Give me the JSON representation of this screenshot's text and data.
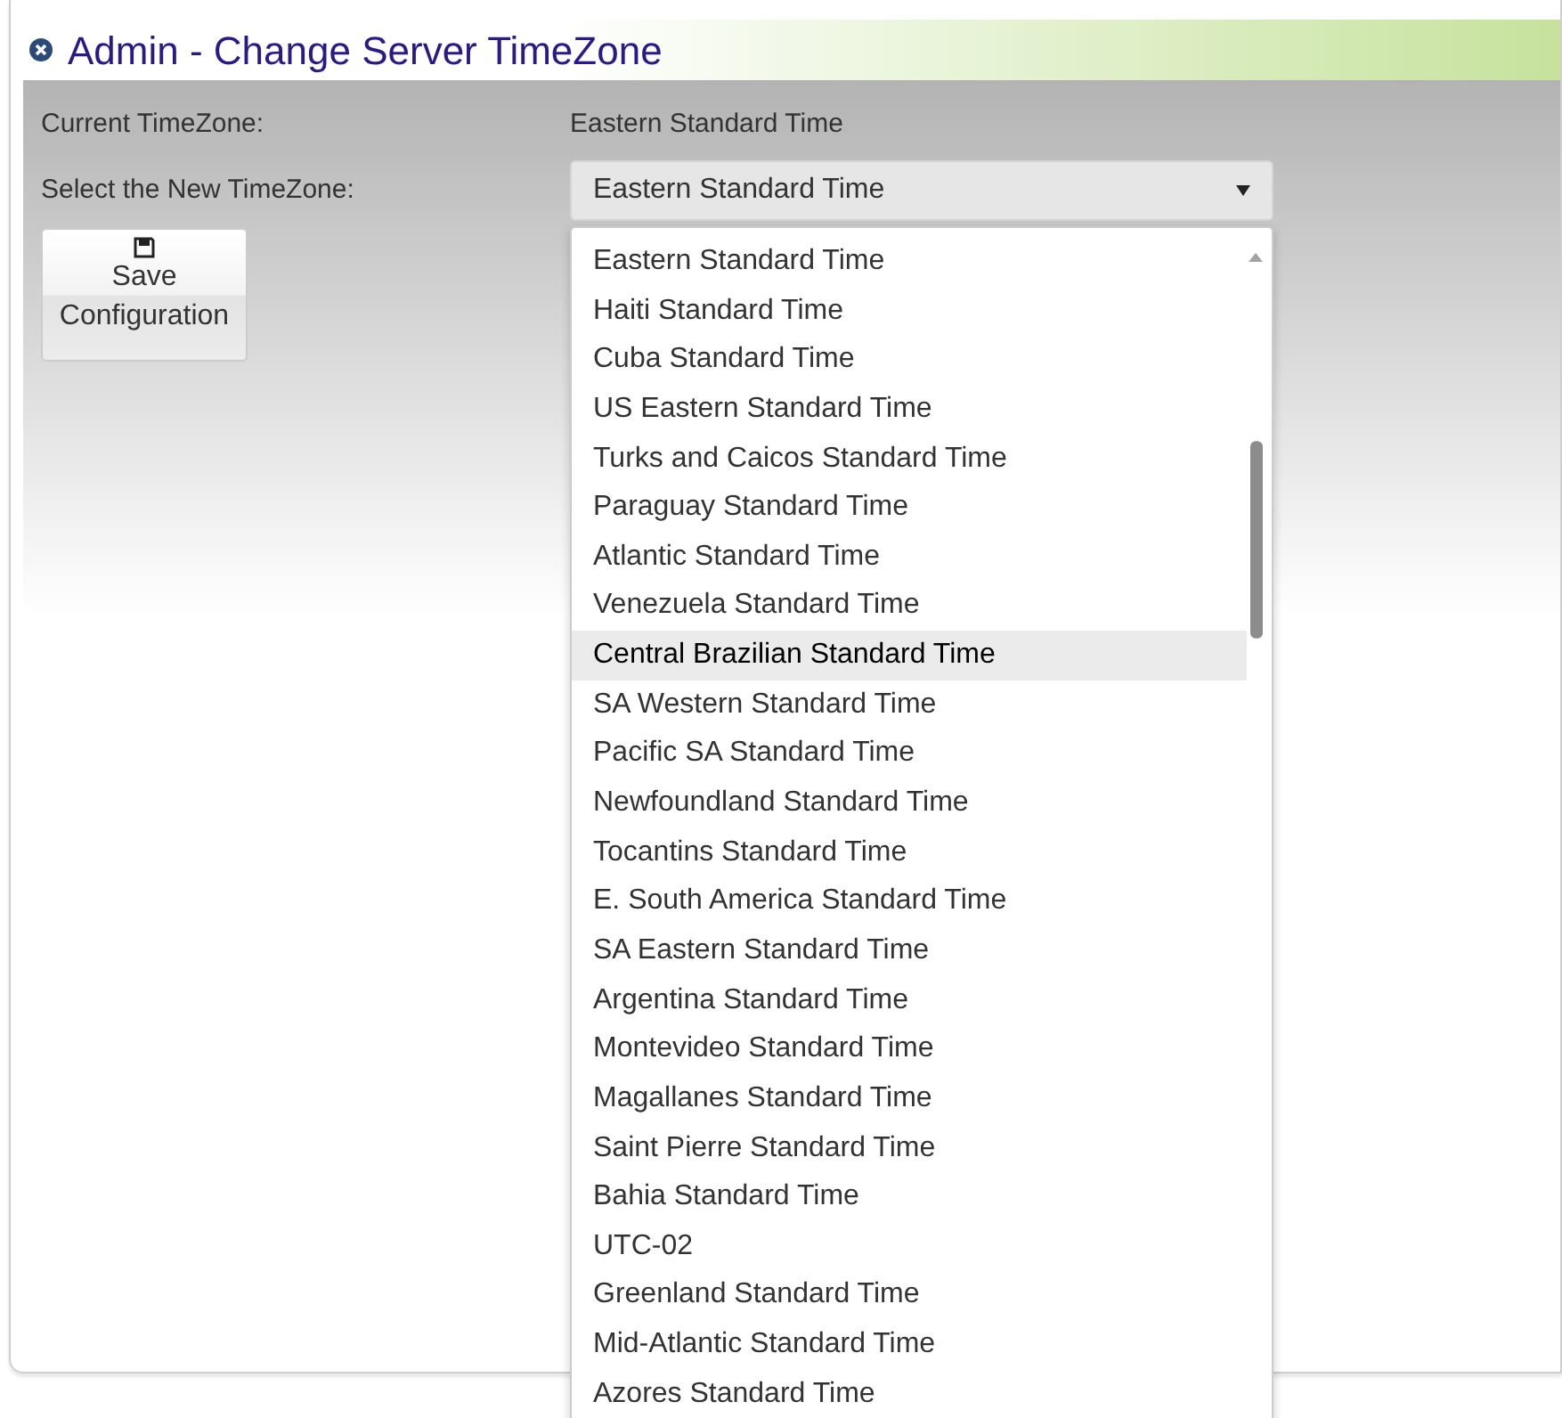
{
  "window": {
    "title": "Admin - Change Server TimeZone"
  },
  "current_timezone": {
    "label": "Current TimeZone:",
    "value": "Eastern Standard Time"
  },
  "new_timezone": {
    "label": "Select the New TimeZone:",
    "value": "Eastern Standard Time",
    "expanded": true
  },
  "save_button": {
    "label": "Save Configuration"
  },
  "options": [
    {
      "label": "Eastern Standard Time",
      "highlighted": false
    },
    {
      "label": "Haiti Standard Time",
      "highlighted": false
    },
    {
      "label": "Cuba Standard Time",
      "highlighted": false
    },
    {
      "label": "US Eastern Standard Time",
      "highlighted": false
    },
    {
      "label": "Turks and Caicos Standard Time",
      "highlighted": false
    },
    {
      "label": "Paraguay Standard Time",
      "highlighted": false
    },
    {
      "label": "Atlantic Standard Time",
      "highlighted": false
    },
    {
      "label": "Venezuela Standard Time",
      "highlighted": false
    },
    {
      "label": "Central Brazilian Standard Time",
      "highlighted": true
    },
    {
      "label": "SA Western Standard Time",
      "highlighted": false
    },
    {
      "label": "Pacific SA Standard Time",
      "highlighted": false
    },
    {
      "label": "Newfoundland Standard Time",
      "highlighted": false
    },
    {
      "label": "Tocantins Standard Time",
      "highlighted": false
    },
    {
      "label": "E. South America Standard Time",
      "highlighted": false
    },
    {
      "label": "SA Eastern Standard Time",
      "highlighted": false
    },
    {
      "label": "Argentina Standard Time",
      "highlighted": false
    },
    {
      "label": "Montevideo Standard Time",
      "highlighted": false
    },
    {
      "label": "Magallanes Standard Time",
      "highlighted": false
    },
    {
      "label": "Saint Pierre Standard Time",
      "highlighted": false
    },
    {
      "label": "Bahia Standard Time",
      "highlighted": false
    },
    {
      "label": "UTC-02",
      "highlighted": false
    },
    {
      "label": "Greenland Standard Time",
      "highlighted": false
    },
    {
      "label": "Mid-Atlantic Standard Time",
      "highlighted": false
    },
    {
      "label": "Azores Standard Time",
      "highlighted": false
    }
  ]
}
